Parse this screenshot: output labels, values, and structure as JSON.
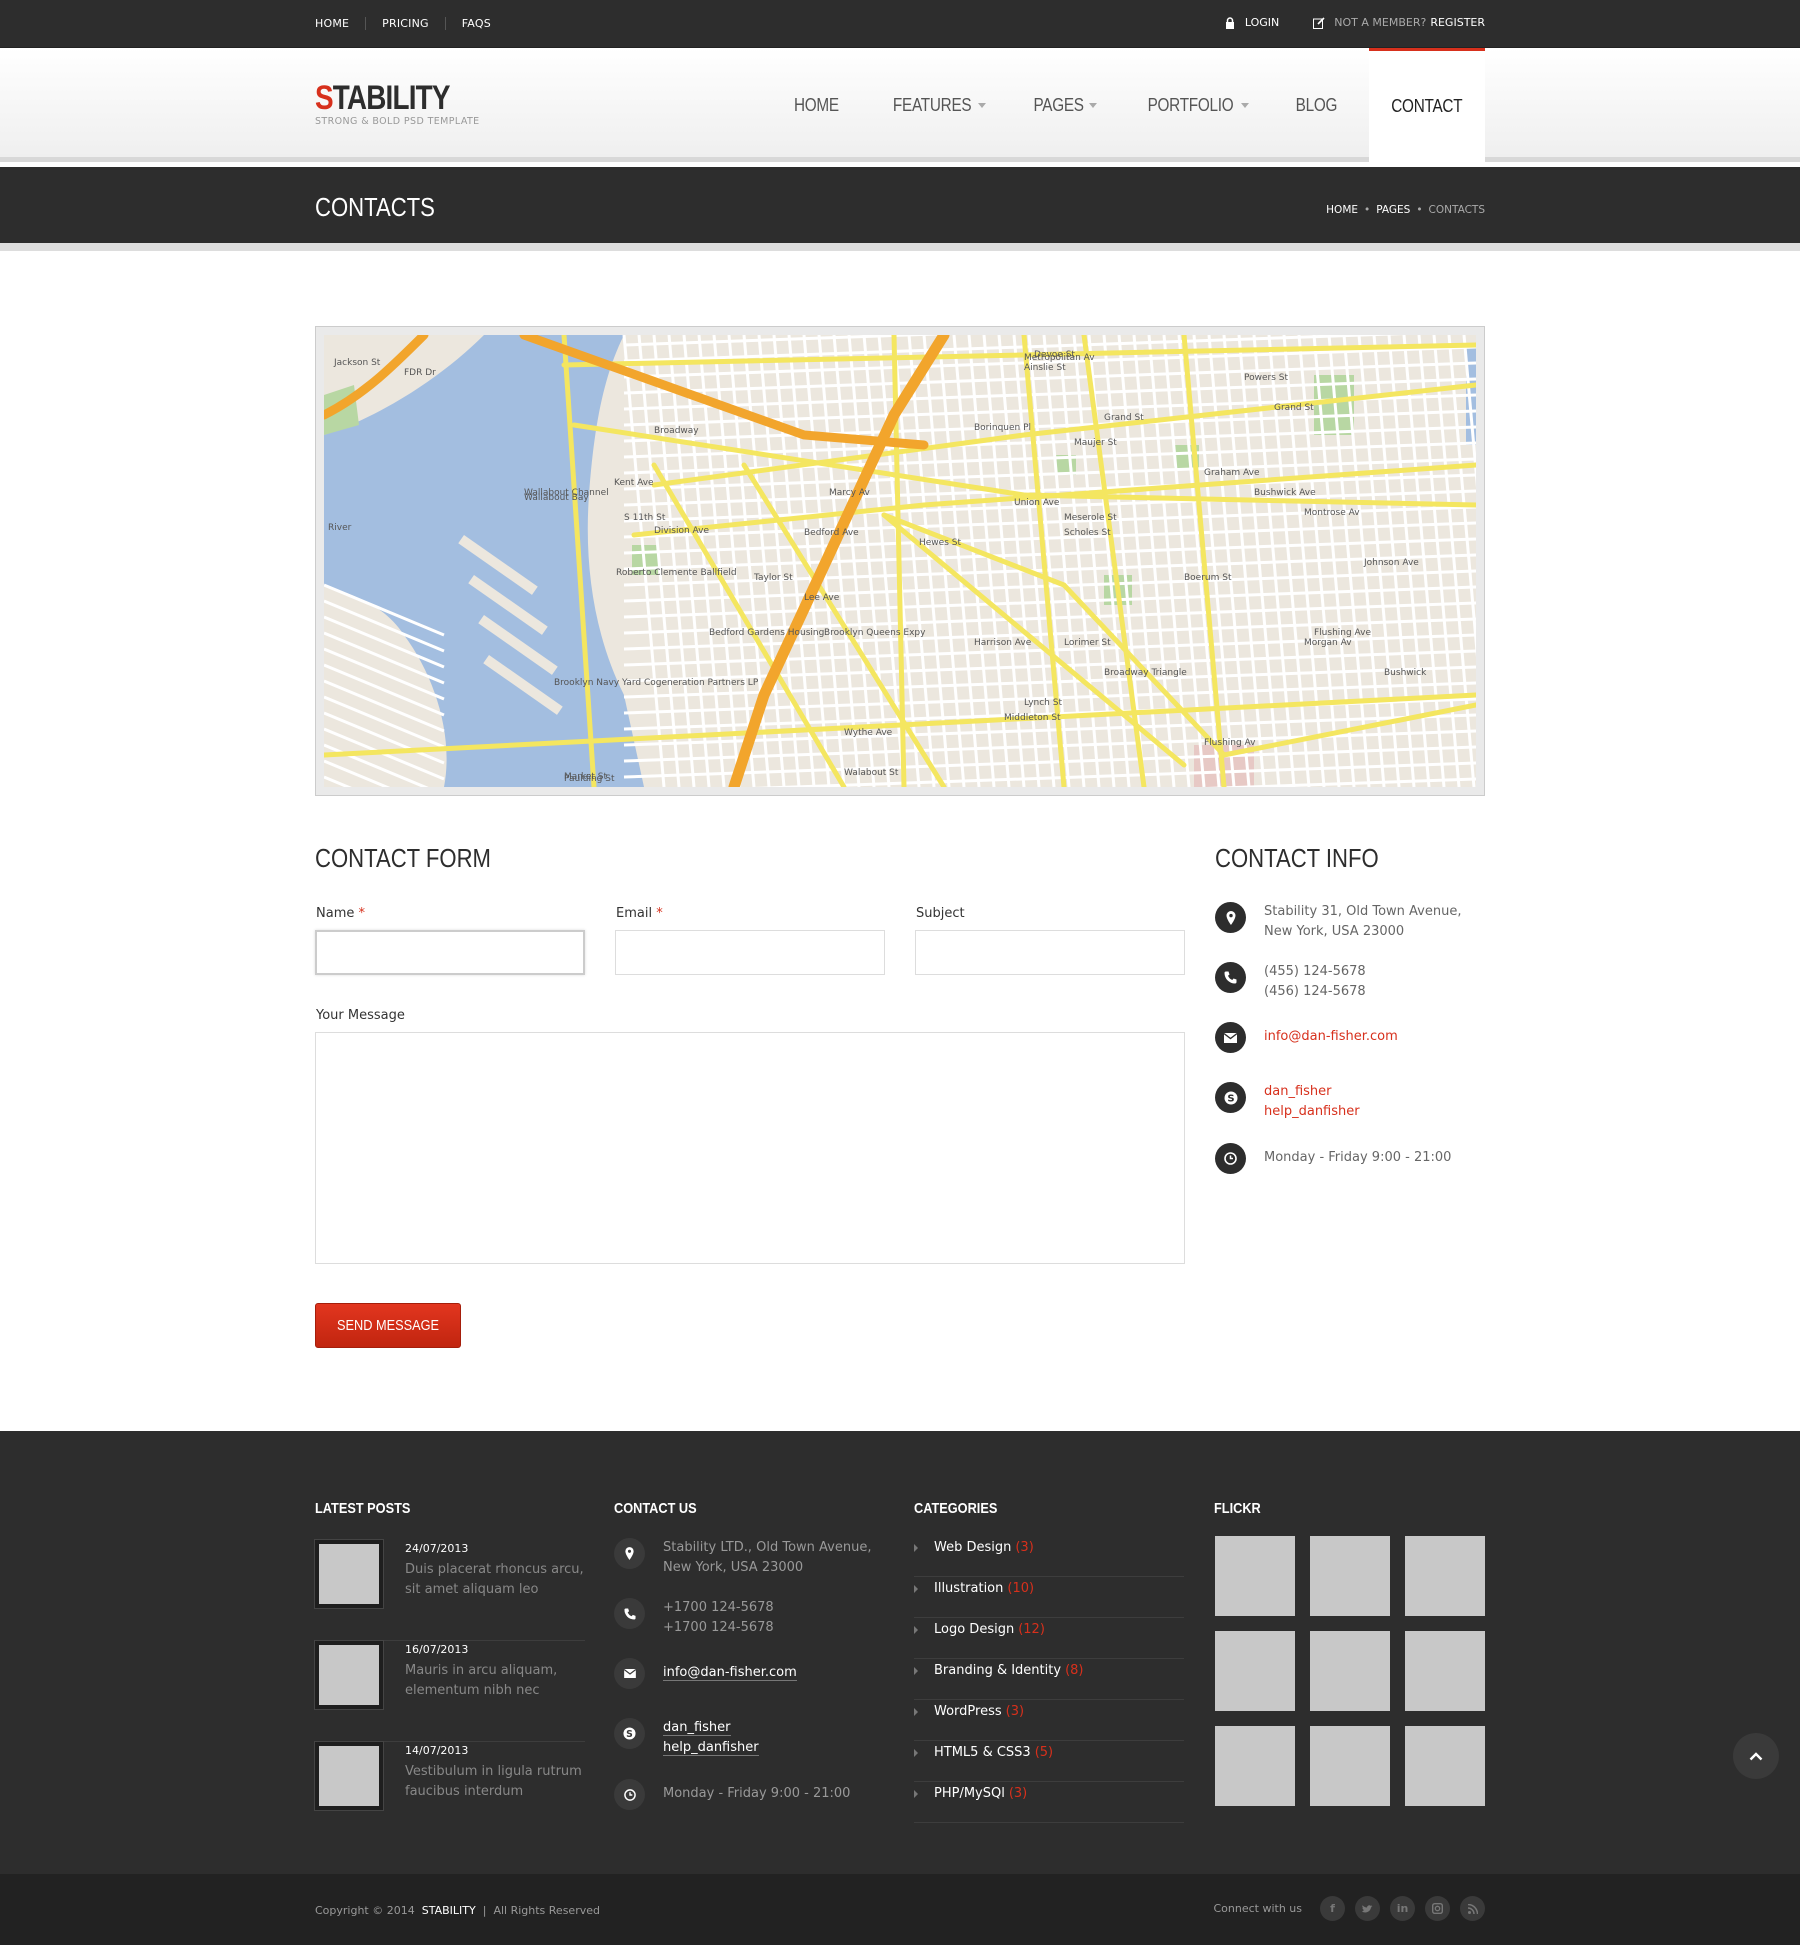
{
  "topbar": {
    "links": [
      "HOME",
      "PRICING",
      "FAQS"
    ],
    "login": "LOGIN",
    "not_member": "NOT A MEMBER?",
    "register": "REGISTER"
  },
  "header": {
    "logo_first": "S",
    "logo_rest": "TABILITY",
    "tagline": "STRONG & BOLD PSD TEMPLATE",
    "nav": [
      {
        "label": "HOME"
      },
      {
        "label": "FEATURES"
      },
      {
        "label": "PAGES"
      },
      {
        "label": "PORTFOLIO"
      },
      {
        "label": "BLOG"
      },
      {
        "label": "CONTACT"
      }
    ]
  },
  "page_title": "CONTACTS",
  "breadcrumb": [
    "HOME",
    "PAGES",
    "CONTACTS"
  ],
  "map": {
    "labels": [
      "Broadway",
      "Kent Ave",
      "Division Ave",
      "Bedford Ave",
      "Lee Ave",
      "Marcy Av",
      "Hewes St",
      "Brooklyn Queens Expy",
      "Grand St",
      "Union Ave",
      "Graham Ave",
      "Bushwick Ave",
      "Montrose Av",
      "Johnson Ave",
      "Morgan Av",
      "Flushing Ave",
      "Broadway Triangle",
      "Lorimer St",
      "Wallabout Bay",
      "Wallabout Channel",
      "Roberto Clemente Ballfield",
      "Bedford Gardens Housing",
      "Brooklyn Navy Yard Cogeneration Partners LP",
      "Metropolitan Av",
      "Powers St",
      "Boerum St",
      "Scholes St",
      "Meserole St",
      "Maujer St",
      "Grand St",
      "Flushing Av",
      "Bushwick",
      "River",
      "FDR Dr",
      "Jackson St",
      "Borinquen Pl",
      "S 11th St",
      "Taylor St",
      "Wythe Ave",
      "Harrison Ave",
      "Middleton St",
      "Lynch St",
      "Walabout St",
      "Market St",
      "Paulding St",
      "Devoe St",
      "Ainslie St"
    ]
  },
  "contact_form": {
    "title": "CONTACT FORM",
    "name_label": "Name",
    "email_label": "Email",
    "subject_label": "Subject",
    "required_mark": "*",
    "message_label": "Your Message",
    "send_label": "SEND MESSAGE"
  },
  "contact_info": {
    "title": "CONTACT INFO",
    "address1": "Stability 31, Old Town Avenue,",
    "address2": "New York, USA 23000",
    "phone1": "(455) 124-5678",
    "phone2": "(456) 124-5678",
    "email": "info@dan-fisher.com",
    "skype1": "dan_fisher",
    "skype2": "help_danfisher",
    "hours": "Monday - Friday 9:00 - 21:00"
  },
  "footer": {
    "latest_posts_title": "LATEST POSTS",
    "posts": [
      {
        "date": "24/07/2013",
        "line1": "Duis placerat rhoncus arcu,",
        "line2": "sit amet aliquam leo"
      },
      {
        "date": "16/07/2013",
        "line1": "Mauris in arcu aliquam,",
        "line2": "elementum nibh nec"
      },
      {
        "date": "14/07/2013",
        "line1": "Vestibulum in ligula rutrum",
        "line2": "faucibus interdum"
      }
    ],
    "contact_title": "CONTACT US",
    "contact": {
      "address1": "Stability LTD., Old Town Avenue,",
      "address2": "New York, USA 23000",
      "phone1": "+1700 124-5678",
      "phone2": "+1700 124-5678",
      "email": "info@dan-fisher.com",
      "skype1": "dan_fisher",
      "skype2": "help_danfisher",
      "hours": "Monday - Friday 9:00 - 21:00"
    },
    "categories_title": "CATEGORIES",
    "categories": [
      {
        "label": "Web Design",
        "count": "(3)"
      },
      {
        "label": "Illustration",
        "count": "(10)"
      },
      {
        "label": "Logo Design",
        "count": "(12)"
      },
      {
        "label": "Branding & Identity",
        "count": "(8)"
      },
      {
        "label": "WordPress",
        "count": "(3)"
      },
      {
        "label": "HTML5 & CSS3",
        "count": "(5)"
      },
      {
        "label": "PHP/MySQl",
        "count": "(3)"
      }
    ],
    "flickr_title": "FLICKR"
  },
  "bottombar": {
    "copyright": "Copyright © 2014",
    "brand": "STABILITY",
    "sep": "|",
    "rights": "All Rights Reserved",
    "connect": "Connect with us",
    "social": [
      "f",
      "t",
      "in",
      "ig",
      "rss"
    ]
  },
  "colors": {
    "accent": "#d7301c",
    "dark": "#2d2d2d",
    "footer": "#2d2d2d",
    "bottombar": "#222222"
  }
}
